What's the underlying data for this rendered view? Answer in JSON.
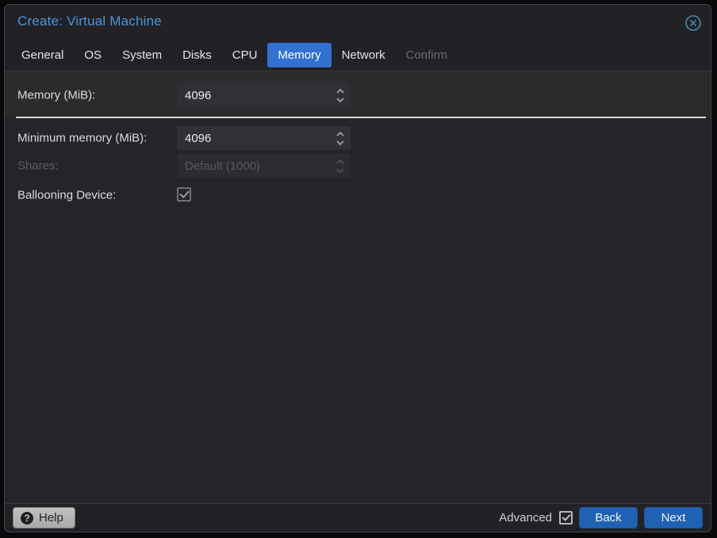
{
  "window": {
    "title": "Create: Virtual Machine"
  },
  "tabs": [
    {
      "label": "General",
      "state": "normal"
    },
    {
      "label": "OS",
      "state": "normal"
    },
    {
      "label": "System",
      "state": "normal"
    },
    {
      "label": "Disks",
      "state": "normal"
    },
    {
      "label": "CPU",
      "state": "normal"
    },
    {
      "label": "Memory",
      "state": "active"
    },
    {
      "label": "Network",
      "state": "normal"
    },
    {
      "label": "Confirm",
      "state": "disabled"
    }
  ],
  "form": {
    "fields": [
      {
        "label": "Memory (MiB):",
        "value": "4096",
        "type": "number-spinner",
        "enabled": true,
        "section": "basic"
      },
      {
        "label": "Minimum memory (MiB):",
        "value": "4096",
        "type": "number-spinner",
        "enabled": true,
        "section": "advanced"
      },
      {
        "label": "Shares:",
        "value": "Default (1000)",
        "type": "number-spinner",
        "enabled": false,
        "section": "advanced"
      },
      {
        "label": "Ballooning Device:",
        "type": "checkbox",
        "checked": true,
        "enabled": true,
        "section": "advanced"
      }
    ]
  },
  "footer": {
    "help_label": "Help",
    "help_icon_glyph": "?",
    "advanced_label": "Advanced",
    "advanced_checked": true,
    "back_label": "Back",
    "next_label": "Next"
  },
  "colors": {
    "title_accent": "#4a94da",
    "active_tab_bg": "#3270d2",
    "primary_button_bg": "#2062b1",
    "dialog_bg": "#252529",
    "header_bg": "#222226",
    "field_bg": "#313135",
    "divider": "#d9d9d9"
  }
}
